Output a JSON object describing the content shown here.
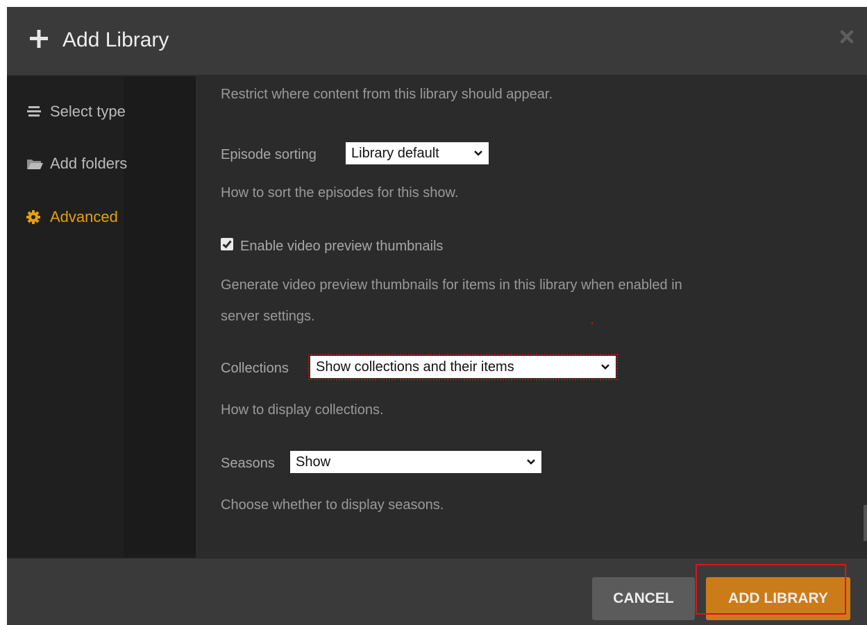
{
  "dialog": {
    "title": "Add Library",
    "icons": {
      "add": "plus-icon",
      "close": "close-icon"
    }
  },
  "sidebar": {
    "items": [
      {
        "label": "Select type",
        "icon": "list-icon",
        "active": false
      },
      {
        "label": "Add folders",
        "icon": "folder-icon",
        "active": false
      },
      {
        "label": "Advanced",
        "icon": "gear-icon",
        "active": true
      }
    ]
  },
  "advanced": {
    "visibility_help": "Restrict where content from this library should appear.",
    "episode_sorting": {
      "label": "Episode sorting",
      "value": "Library default",
      "help": "How to sort the episodes for this show."
    },
    "video_preview": {
      "label": "Enable video preview thumbnails",
      "checked": true,
      "help_line1": "Generate video preview thumbnails for items in this library when enabled in",
      "help_line2": "server settings."
    },
    "collections": {
      "label": "Collections",
      "value": "Show collections and their items",
      "help": "How to display collections."
    },
    "seasons": {
      "label": "Seasons",
      "value": "Show",
      "help": "Choose whether to display seasons."
    }
  },
  "footer": {
    "cancel_label": "CANCEL",
    "add_label": "ADD LIBRARY"
  },
  "colors": {
    "accent": "#e5a00d",
    "primary_button": "#cc7b19",
    "secondary_button": "#5b5b5b",
    "highlight": "#e0121a"
  }
}
